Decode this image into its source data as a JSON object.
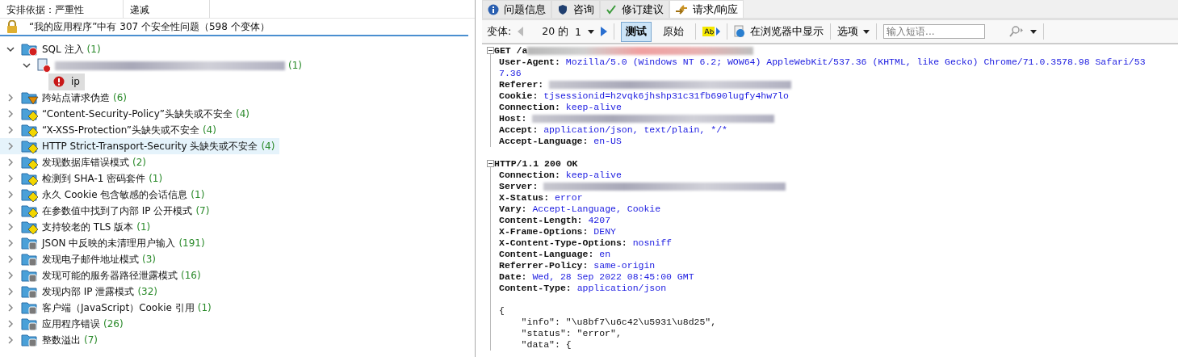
{
  "sort_bar": {
    "label": "安排依据：严重性",
    "order": "递减"
  },
  "summary": "“我的应用程序”中有 307 个安全性问题（598 个变体）",
  "issues": [
    {
      "label": "SQL 注入",
      "count": "(1)",
      "kind": "high",
      "expanded": true,
      "selected": false,
      "hot": false,
      "children": [
        {
          "kind": "url",
          "redacted": true,
          "count": "(1)",
          "expanded": true,
          "selected": false,
          "hot": false,
          "children": [
            {
              "kind": "param",
              "label": "ip",
              "selected": true,
              "hot": false
            }
          ]
        }
      ]
    },
    {
      "label": "跨站点请求伪造",
      "count": "(6)",
      "kind": "medium",
      "expanded": false,
      "selected": false,
      "hot": false
    },
    {
      "label": "“Content-Security-Policy”头缺失或不安全",
      "count": "(4)",
      "kind": "low",
      "expanded": false,
      "selected": false,
      "hot": false
    },
    {
      "label": "“X-XSS-Protection”头缺失或不安全",
      "count": "(4)",
      "kind": "low",
      "expanded": false,
      "selected": false,
      "hot": false
    },
    {
      "label": "HTTP Strict-Transport-Security 头缺失或不安全",
      "count": "(4)",
      "kind": "low",
      "expanded": false,
      "selected": false,
      "hot": true
    },
    {
      "label": "发现数据库错误模式",
      "count": "(2)",
      "kind": "low",
      "expanded": false,
      "selected": false,
      "hot": false
    },
    {
      "label": "检测到 SHA-1 密码套件",
      "count": "(1)",
      "kind": "low",
      "expanded": false,
      "selected": false,
      "hot": false
    },
    {
      "label": "永久 Cookie 包含敏感的会话信息",
      "count": "(1)",
      "kind": "low",
      "expanded": false,
      "selected": false,
      "hot": false
    },
    {
      "label": "在参数值中找到了内部 IP 公开模式",
      "count": "(7)",
      "kind": "low",
      "expanded": false,
      "selected": false,
      "hot": false
    },
    {
      "label": "支持较老的 TLS 版本",
      "count": "(1)",
      "kind": "low",
      "expanded": false,
      "selected": false,
      "hot": false
    },
    {
      "label": "JSON 中反映的未清理用户输入",
      "count": "(191)",
      "kind": "info",
      "expanded": false,
      "selected": false,
      "hot": false
    },
    {
      "label": "发现电子邮件地址模式",
      "count": "(3)",
      "kind": "info",
      "expanded": false,
      "selected": false,
      "hot": false
    },
    {
      "label": "发现可能的服务器路径泄露模式",
      "count": "(16)",
      "kind": "info",
      "expanded": false,
      "selected": false,
      "hot": false
    },
    {
      "label": "发现内部 IP 泄露模式",
      "count": "(32)",
      "kind": "info",
      "expanded": false,
      "selected": false,
      "hot": false
    },
    {
      "label": "客户端（JavaScript）Cookie 引用",
      "count": "(1)",
      "kind": "info",
      "expanded": false,
      "selected": false,
      "hot": false
    },
    {
      "label": "应用程序错误",
      "count": "(26)",
      "kind": "info",
      "expanded": false,
      "selected": false,
      "hot": false
    },
    {
      "label": "整数溢出",
      "count": "(7)",
      "kind": "info",
      "expanded": false,
      "selected": false,
      "hot": false
    }
  ],
  "tabs": [
    {
      "kind": "info",
      "label": "问题信息",
      "selected": false
    },
    {
      "kind": "shield",
      "label": "咨询",
      "selected": false
    },
    {
      "kind": "check",
      "label": "修订建议",
      "selected": false
    },
    {
      "kind": "exchange",
      "label": "请求/响应",
      "selected": true
    }
  ],
  "toolbar": {
    "variant_label": "变体:",
    "variant_total": "20 的",
    "variant_index": "1",
    "modes": [
      {
        "label": "测试",
        "selected": true
      },
      {
        "label": "原始",
        "selected": false
      }
    ],
    "browser_button": "在浏览器中显示",
    "options": "选项",
    "search": {
      "placeholder": "输入短语..."
    }
  },
  "request": {
    "first_line": "GET /a",
    "first_line_redacted": true,
    "headers": [
      {
        "key": "User-Agent:",
        "value": "Mozilla/5.0 (Windows NT 6.2; WOW64) AppleWebKit/537.36 (KHTML, like Gecko) Chrome/71.0.3578.98 Safari/537.36",
        "redacted": false
      },
      {
        "key": "Referer:",
        "redacted": true
      },
      {
        "key": "Cookie:",
        "value": "tjsessionid=h2vqk6jhshp31c31fb690lugfy4hw7lo",
        "redacted": false
      },
      {
        "key": "Connection:",
        "value": "keep-alive",
        "redacted": false
      },
      {
        "key": "Host:",
        "redacted": true
      },
      {
        "key": "Accept:",
        "value": "application/json, text/plain, */*",
        "redacted": false
      },
      {
        "key": "Accept-Language:",
        "value": "en-US",
        "redacted": false
      }
    ]
  },
  "response": {
    "first_line": "HTTP/1.1 200 OK",
    "headers": [
      {
        "key": "Connection:",
        "value": "keep-alive",
        "redacted": false
      },
      {
        "key": "Server:",
        "redacted": true
      },
      {
        "key": "X-Status:",
        "value": "error",
        "redacted": false
      },
      {
        "key": "Vary:",
        "value": "Accept-Language, Cookie",
        "redacted": false
      },
      {
        "key": "Content-Length:",
        "value": "4207",
        "redacted": false
      },
      {
        "key": "X-Frame-Options:",
        "value": "DENY",
        "redacted": false
      },
      {
        "key": "X-Content-Type-Options:",
        "value": "nosniff",
        "redacted": false
      },
      {
        "key": "Content-Language:",
        "value": "en",
        "redacted": false
      },
      {
        "key": "Referrer-Policy:",
        "value": "same-origin",
        "redacted": false
      },
      {
        "key": "Date:",
        "value": "Wed, 28 Sep 2022 08:45:00 GMT",
        "redacted": false
      },
      {
        "key": "Content-Type:",
        "value": "application/json",
        "redacted": false
      }
    ],
    "body": [
      "{",
      "    \"info\": \"\\u8bf7\\u6c42\\u5931\\u8d25\",",
      "    \"status\": \"error\",",
      "    \"data\": {"
    ]
  }
}
